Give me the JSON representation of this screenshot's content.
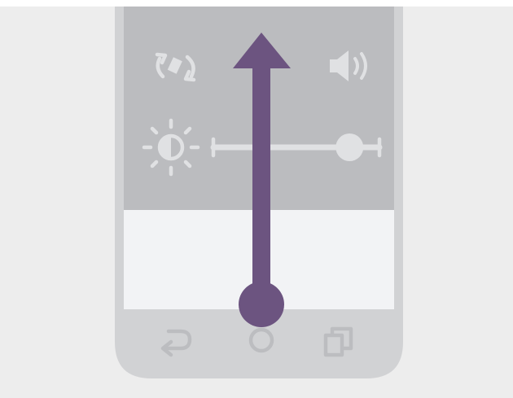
{
  "colors": {
    "background": "#ededed",
    "phone_body": "#d1d2d4",
    "quick_settings_panel": "#bbbcbf",
    "icon_muted": "#e0e1e3",
    "screen_blank": "#f2f3f5",
    "nav_icon": "#bcbdc0",
    "gesture_arrow": "#6c5480"
  },
  "quick_settings": {
    "rotate_icon": "auto-rotate-icon",
    "volume_icon": "volume-icon",
    "brightness_icon": "brightness-icon",
    "brightness_level": 0.82
  },
  "navigation_bar": {
    "back_icon": "back-icon",
    "home_icon": "home-icon",
    "recents_icon": "recents-icon"
  },
  "gesture": {
    "type": "swipe-up",
    "direction": "up"
  }
}
